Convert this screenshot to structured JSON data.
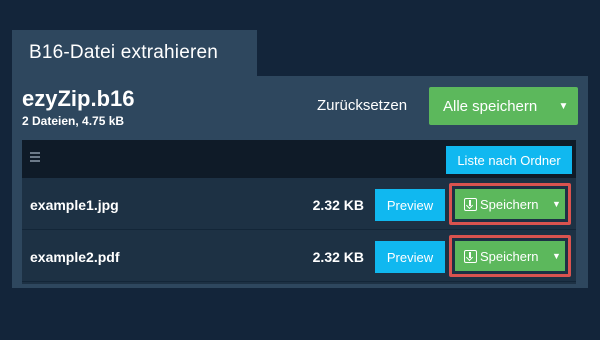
{
  "tab": {
    "title": "B16-Datei extrahieren"
  },
  "archive": {
    "name": "ezyZip.b16",
    "meta": "2 Dateien, 4.75 kB"
  },
  "actions": {
    "reset_label": "Zurücksetzen",
    "save_all_label": "Alle speichern",
    "save_all_caret": "▼"
  },
  "list": {
    "folder_button_label": "Liste nach Ordner",
    "rows": [
      {
        "name": "example1.jpg",
        "size": "2.32 KB",
        "preview_label": "Preview",
        "save_label": "Speichern",
        "caret": "▼"
      },
      {
        "name": "example2.pdf",
        "size": "2.32 KB",
        "preview_label": "Preview",
        "save_label": "Speichern",
        "caret": "▼"
      }
    ]
  },
  "colors": {
    "background": "#13253a",
    "panel": "#2e475e",
    "green": "#5cb85c",
    "blue": "#10b8f0",
    "highlight": "#d9534f"
  },
  "icons": [
    "menu-icon",
    "download-icon",
    "caret-down-icon"
  ]
}
